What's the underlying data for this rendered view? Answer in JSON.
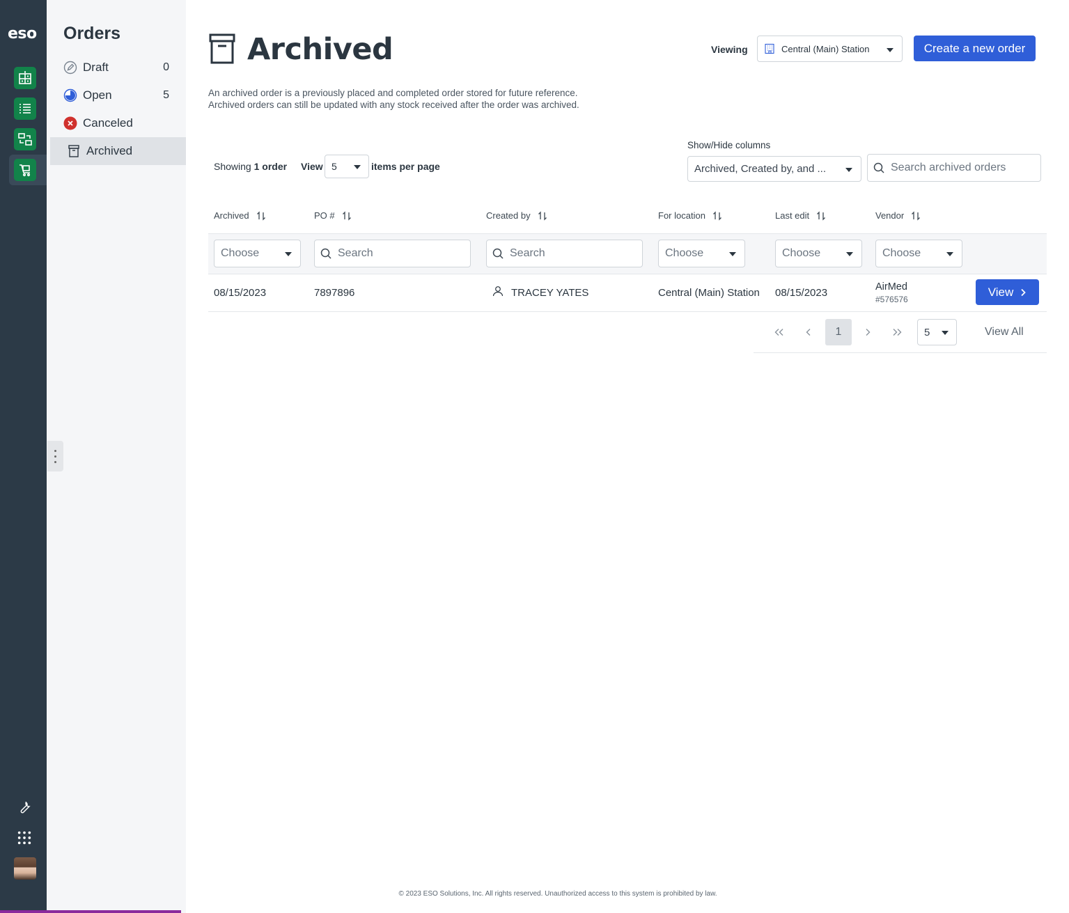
{
  "rail": {
    "logo": "eso",
    "apps": [
      "add-grid-icon",
      "list-icon",
      "transfer-icon",
      "cart-icon"
    ],
    "bottom": [
      "wrench-icon",
      "apps-grid-icon",
      "avatar"
    ]
  },
  "subnav": {
    "title": "Orders",
    "items": [
      {
        "label": "Draft",
        "count": "0",
        "icon": "pencil-circle-icon"
      },
      {
        "label": "Open",
        "count": "5",
        "icon": "clock-pie-icon"
      },
      {
        "label": "Canceled",
        "count": "",
        "icon": "x-circle-icon"
      },
      {
        "label": "Archived",
        "count": "",
        "icon": "archive-box-icon"
      }
    ]
  },
  "header": {
    "title": "Archived",
    "viewing_label": "Viewing",
    "viewing_value": "Central (Main) Station",
    "create_button": "Create a new order"
  },
  "description": {
    "line1": "An archived order is a previously placed and completed order stored for future reference.",
    "line2": "Archived orders can still be updated with any stock received after the order was archived."
  },
  "toolbar": {
    "showing_prefix": "Showing",
    "showing_count": "1 order",
    "view_label": "View",
    "items_per_page": "5",
    "items_per_page_label": "items per page",
    "show_hide_label": "Show/Hide columns",
    "show_hide_value": "Archived, Created by, and ...",
    "search_placeholder": "Search archived orders"
  },
  "table": {
    "columns": [
      "Archived",
      "PO #",
      "Created by",
      "For location",
      "Last edit",
      "Vendor"
    ],
    "filters": {
      "choose": "Choose",
      "search": "Search"
    },
    "rows": [
      {
        "archived": "08/15/2023",
        "po": "7897896",
        "created_by": "TRACEY YATES",
        "location": "Central (Main) Station",
        "last_edit": "08/15/2023",
        "vendor_name": "AirMed",
        "vendor_number": "#576576",
        "action": "View"
      }
    ]
  },
  "pagination": {
    "current_page": "1",
    "page_size": "5",
    "view_all": "View All"
  },
  "footer": "© 2023 ESO Solutions, Inc. All rights reserved. Unauthorized access to this system is prohibited by law.",
  "colors": {
    "rail": "#2c3a47",
    "app_green": "#12834a",
    "primary": "#2f5ed8",
    "subnav_bg": "#f5f6f8"
  }
}
